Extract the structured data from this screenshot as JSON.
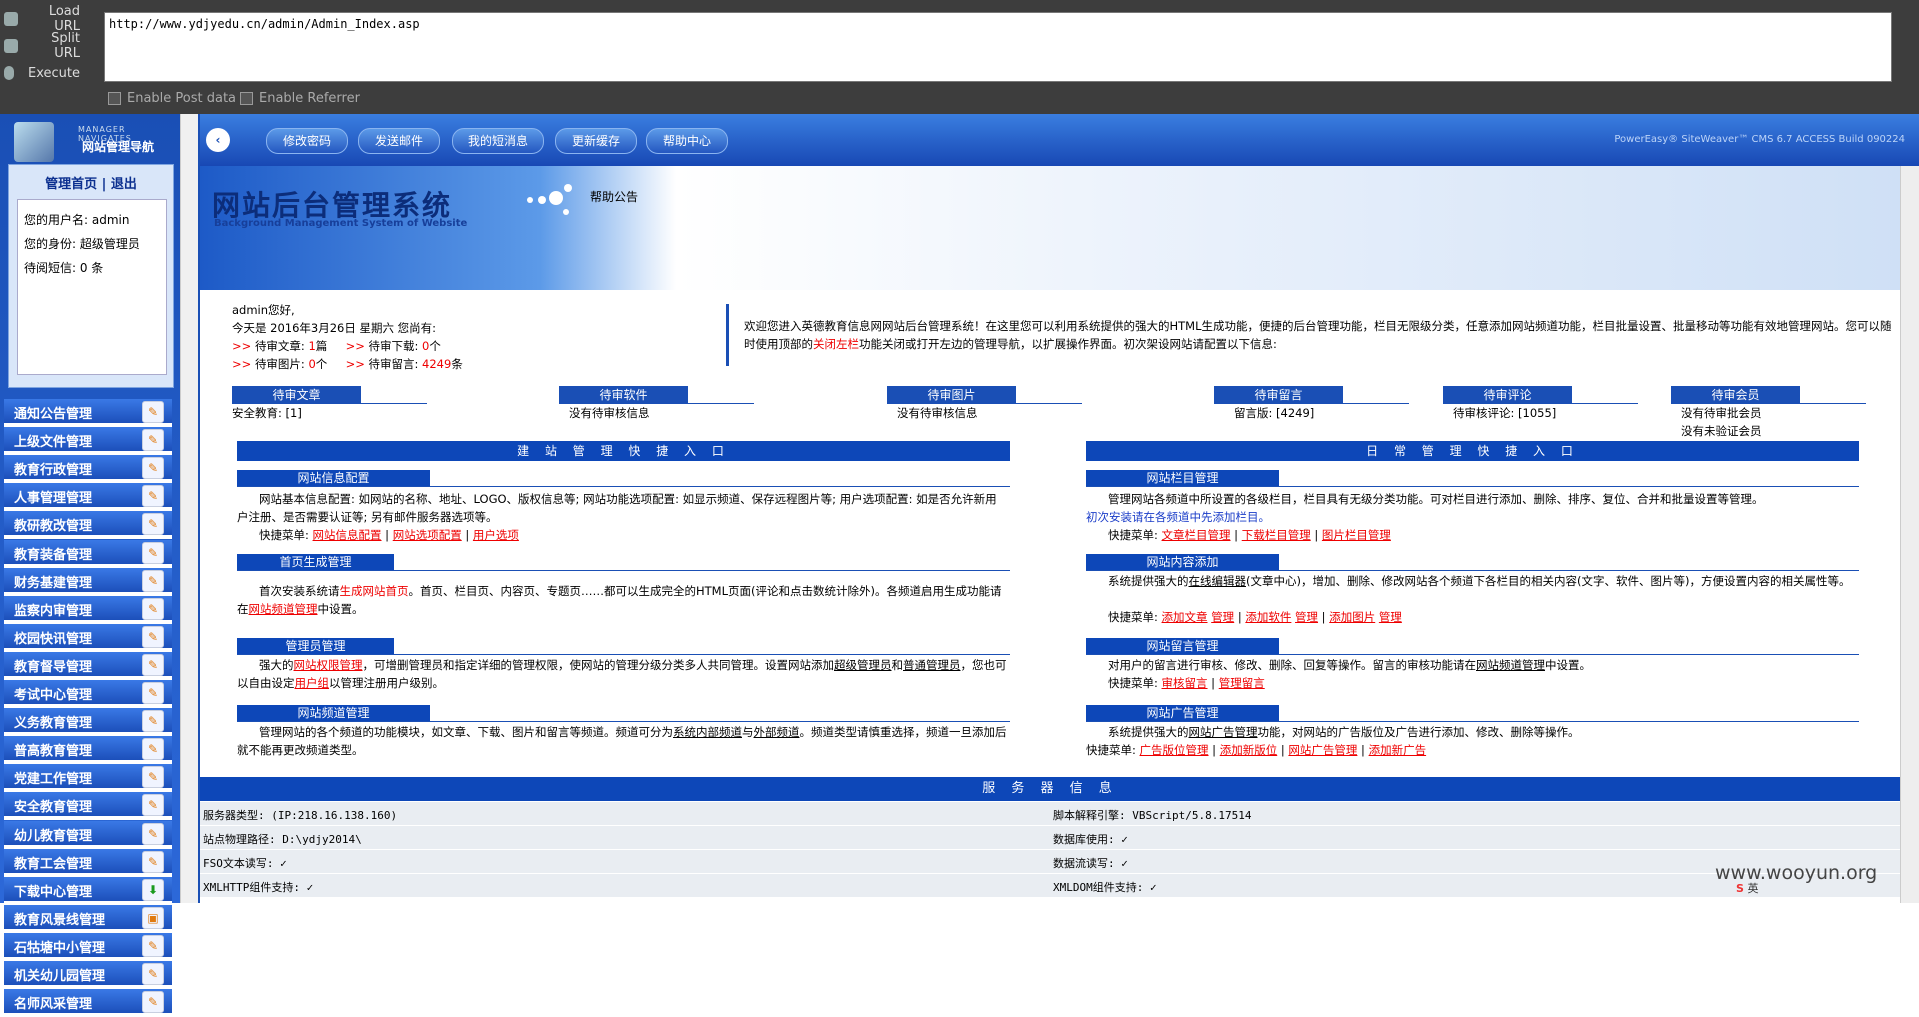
{
  "hackbar": {
    "load_url": "Load URL",
    "split_url": "Split URL",
    "execute": "Execute",
    "url": "http://www.ydjyedu.cn/admin/Admin_Index.asp",
    "enable_post": "Enable Post data",
    "enable_referrer": "Enable Referrer"
  },
  "leftnav": {
    "small_title": "MANAGER NAVIGATES",
    "title": "网站管理导航",
    "links": "管理首页 | 退出",
    "user_label": "您的用户名: admin",
    "role_label": "您的身份: 超级管理员",
    "sms_label": "待阅短信:  0 条",
    "items": [
      {
        "label": "通知公告管理",
        "icon": "edit-icon"
      },
      {
        "label": "上级文件管理",
        "icon": "edit-icon"
      },
      {
        "label": "教育行政管理",
        "icon": "edit-icon"
      },
      {
        "label": "人事管理管理",
        "icon": "edit-icon"
      },
      {
        "label": "教研教改管理",
        "icon": "edit-icon"
      },
      {
        "label": "教育装备管理",
        "icon": "edit-icon"
      },
      {
        "label": "财务基建管理",
        "icon": "edit-icon"
      },
      {
        "label": "监察内审管理",
        "icon": "edit-icon"
      },
      {
        "label": "校园快讯管理",
        "icon": "edit-icon"
      },
      {
        "label": "教育督导管理",
        "icon": "edit-icon"
      },
      {
        "label": "考试中心管理",
        "icon": "edit-icon"
      },
      {
        "label": "义务教育管理",
        "icon": "edit-icon"
      },
      {
        "label": "普高教育管理",
        "icon": "edit-icon"
      },
      {
        "label": "党建工作管理",
        "icon": "edit-icon"
      },
      {
        "label": "安全教育管理",
        "icon": "edit-icon"
      },
      {
        "label": "幼儿教育管理",
        "icon": "edit-icon"
      },
      {
        "label": "教育工会管理",
        "icon": "edit-icon"
      },
      {
        "label": "下载中心管理",
        "icon": "download-icon"
      },
      {
        "label": "教育风景线管理",
        "icon": "photo-icon"
      },
      {
        "label": "石牯塘中小管理",
        "icon": "edit-icon"
      },
      {
        "label": "机关幼儿园管理",
        "icon": "edit-icon"
      },
      {
        "label": "名师风采管理",
        "icon": "edit-icon"
      }
    ]
  },
  "topbar": {
    "buttons": [
      "修改密码",
      "发送邮件",
      "我的短消息",
      "更新缓存",
      "帮助中心"
    ],
    "version": "PowerEasy® SiteWeaver™ CMS 6.7 ACCESS Build 090224"
  },
  "banner": {
    "title": "网站后台管理系统",
    "subtitle": "Background Management System of Website",
    "help": "帮助公告"
  },
  "welcome": {
    "greeting": "admin您好,",
    "today": "今天是 2016年3月26日 星期六 您尚有:",
    "pending_article": "待审文章: ",
    "pending_article_val": "1",
    "pending_article_unit": "篇",
    "pending_download": "待审下载: ",
    "pending_download_val": "0",
    "pending_download_unit": "个",
    "pending_photo": "待审图片: ",
    "pending_photo_val": "0",
    "pending_photo_unit": "个",
    "pending_msg": "待审留言: ",
    "pending_msg_val": "4249",
    "pending_msg_unit": "条",
    "intro": "欢迎您进入英德教育信息网网站后台管理系统！在这里您可以利用系统提供的强大的HTML生成功能，便捷的后台管理功能，栏目无限级分类，任意添加网站频道功能，栏目批量设置、批量移动等功能有效地管理网站。您可以随时使用顶部的",
    "intro_link": "关闭左栏",
    "intro_end": "功能关闭或打开左边的管理导航，以扩展操作界面。初次架设网站请配置以下信息:"
  },
  "pending": [
    {
      "head": "待审文章",
      "line1": "安全教育: [1]",
      "line2": ""
    },
    {
      "head": "待审软件",
      "line1": "没有待审核信息",
      "line2": ""
    },
    {
      "head": "待审图片",
      "line1": "没有待审核信息",
      "line2": ""
    },
    {
      "head": "待审留言",
      "line1": "留言版: [4249]",
      "line2": ""
    },
    {
      "head": "待审评论",
      "line1": "待审核评论: [1055]",
      "line2": ""
    },
    {
      "head": "待审会员",
      "line1": "没有待审批会员",
      "line2": "没有未验证会员"
    }
  ],
  "left_section": {
    "title": "建 站 管 理 快 捷 入 口",
    "blocks": [
      {
        "head": "网站信息配置",
        "text": "网站基本信息配置: 如网站的名称、地址、LOGO、版权信息等; 网站功能选项配置: 如显示频道、保存远程图片等; 用户选项配置: 如是否允许新用户注册、是否需要认证等; 另有邮件服务器选项等。",
        "menu_label": "快捷菜单:",
        "menu": [
          "网站信息配置",
          "网站选项配置",
          "用户选项"
        ]
      },
      {
        "head": "首页生成管理",
        "text1": "首次安装系统请",
        "link1": "生成网站首页",
        "text2": "。首页、栏目页、内容页、专题页……都可以生成完全的HTML页面(评论和点击数统计除外)。各频道启用生成功能请在",
        "link2": "网站频道管理",
        "text3": "中设置。"
      },
      {
        "head": "管理员管理",
        "text1": "强大的",
        "link1": "网站权限管理",
        "text2": "，可增删管理员和指定详细的管理权限，使网站的管理分级分类多人共同管理。设置网站添加",
        "u1": "超级管理员",
        "text3": "和",
        "u2": "普通管理员",
        "text4": "，您也可以自由设定",
        "link2": "用户组",
        "text5": "以管理注册用户级别。"
      },
      {
        "head": "网站频道管理",
        "text1": "管理网站的各个频道的功能模块，如文章、下载、图片和留言等频道。频道可分为",
        "u1": "系统内部频道",
        "text2": "与",
        "u2": "外部频道",
        "text3": "。频道类型请慎重选择，频道一旦添加后就不能再更改频道类型。"
      }
    ]
  },
  "right_section": {
    "title": "日 常 管 理 快 捷 入 口",
    "blocks": [
      {
        "head": "网站栏目管理",
        "text": "管理网站各频道中所设置的各级栏目，栏目具有无级分类功能。可对栏目进行添加、删除、排序、复位、合并和批量设置等管理。",
        "blue": "初次安装请在各频道中先添加栏目。",
        "menu_label": "快捷菜单:",
        "menu": [
          "文章栏目管理",
          "下载栏目管理",
          "图片栏目管理"
        ]
      },
      {
        "head": "网站内容添加",
        "text1": "系统提供强大的",
        "u1": "在线编辑器",
        "text2": "(文章中心)，增加、删除、修改网站各个频道下各栏目的相关内容(文字、软件、图片等)，方便设置内容的相关属性等。",
        "menu_label": "快捷菜单:",
        "menu": [
          "添加文章",
          "管理",
          "添加软件",
          "管理",
          "添加图片",
          "管理"
        ]
      },
      {
        "head": "网站留言管理",
        "text1": "对用户的留言进行审核、修改、删除、回复等操作。留言的审核功能请在",
        "u1": "网站频道管理",
        "text2": "中设置。",
        "menu_label": "快捷菜单:",
        "menu": [
          "审核留言",
          "管理留言"
        ]
      },
      {
        "head": "网站广告管理",
        "text1": "系统提供强大的",
        "u1": "网站广告管理",
        "text2": "功能，对网站的广告版位及广告进行添加、修改、删除等操作。",
        "menu_label": "快捷菜单:",
        "menu": [
          "广告版位管理",
          "添加新版位",
          "网站广告管理",
          "添加新广告"
        ]
      }
    ]
  },
  "server": {
    "title": "服 务 器 信 息",
    "rows": [
      [
        "服务器类型:  (IP:218.16.138.160)",
        "脚本解释引擎:  VBScript/5.8.17514"
      ],
      [
        "站点物理路径:  D:\\ydjy2014\\",
        "数据库使用: ✓"
      ],
      [
        "FSO文本读写: ✓",
        "数据流读写: ✓"
      ],
      [
        "XMLHTTP组件支持: ✓",
        "XMLDOM组件支持: ✓"
      ]
    ]
  },
  "watermark": "www.wooyun.org",
  "tray": "英"
}
